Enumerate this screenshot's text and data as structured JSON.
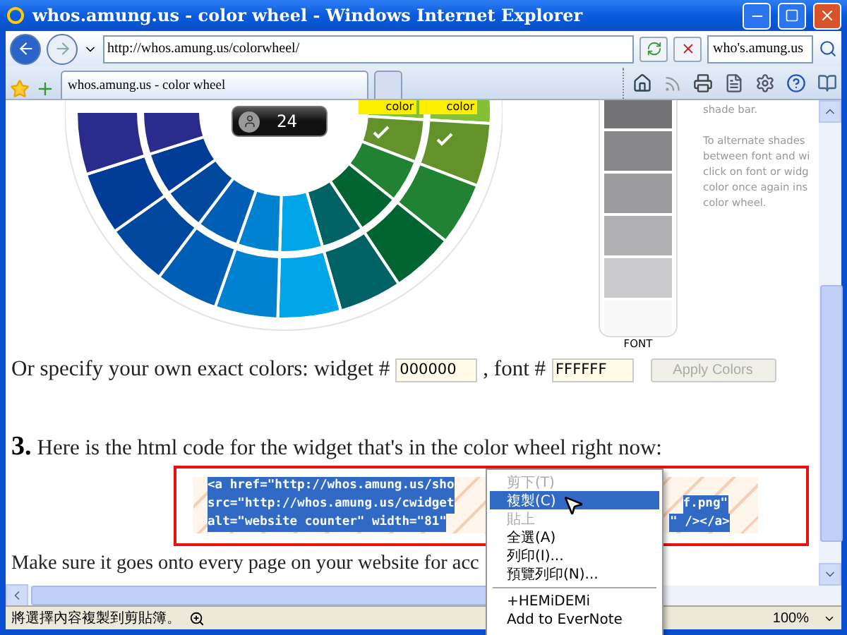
{
  "window": {
    "title": "whos.amung.us - color wheel - Windows Internet Explorer"
  },
  "address_bar": {
    "url": "http://whos.amung.us/colorwheel/"
  },
  "search": {
    "value": "who's.amung.us"
  },
  "tabs": [
    {
      "label": "whos.amung.us - color wheel",
      "selected": true
    }
  ],
  "page": {
    "counter": "24",
    "wheel_labels": [
      {
        "text": "color",
        "checked": true
      },
      {
        "text": "color",
        "checked": true
      }
    ],
    "shade_label": "FONT",
    "side_note": [
      [
        "shade bar."
      ],
      [
        "To alternate shades",
        "between font and wi",
        "click on font or widg",
        "color once again ins",
        "color wheel."
      ]
    ],
    "form": {
      "prefix": "Or specify your own exact colors: widget #",
      "widget_value": "000000",
      "font_label": ", font #",
      "font_value": "FFFFFF",
      "apply_button": {
        "label": "Apply Colors",
        "disabled": true
      }
    },
    "step": {
      "number": "3.",
      "text": "Here is the html code for the widget that's in the color wheel right now:"
    },
    "code_lines": [
      {
        "left": "<a href=\"http://whos.amung.us/sho"
      },
      {
        "left": "src=\"http://whos.amung.us/cwidget",
        "right": "f.png\""
      },
      {
        "left": "alt=\"website counter\" width=\"81\"",
        "right": "\" /></a>"
      }
    ],
    "footer_text": "Make sure it goes onto every page on your website for acc"
  },
  "context_menu": [
    {
      "kind": "item",
      "label": "剪下(T)",
      "disabled": true,
      "selected": false
    },
    {
      "kind": "item",
      "label": "複製(C)",
      "disabled": false,
      "selected": true
    },
    {
      "kind": "item",
      "label": "貼上",
      "disabled": true,
      "selected": false
    },
    {
      "kind": "item",
      "label": "全選(A)",
      "disabled": false,
      "selected": false
    },
    {
      "kind": "item",
      "label": "列印(I)...",
      "disabled": false,
      "selected": false
    },
    {
      "kind": "item",
      "label": "預覽列印(N)...",
      "disabled": false,
      "selected": false
    },
    {
      "kind": "separator"
    },
    {
      "kind": "item",
      "label": "+HEMiDEMi",
      "disabled": false,
      "selected": false
    },
    {
      "kind": "item",
      "label": "Add to EverNote",
      "disabled": false,
      "selected": false
    }
  ],
  "status_bar": {
    "text": "將選擇內容複製到剪貼簿。",
    "zoom": "100%"
  }
}
